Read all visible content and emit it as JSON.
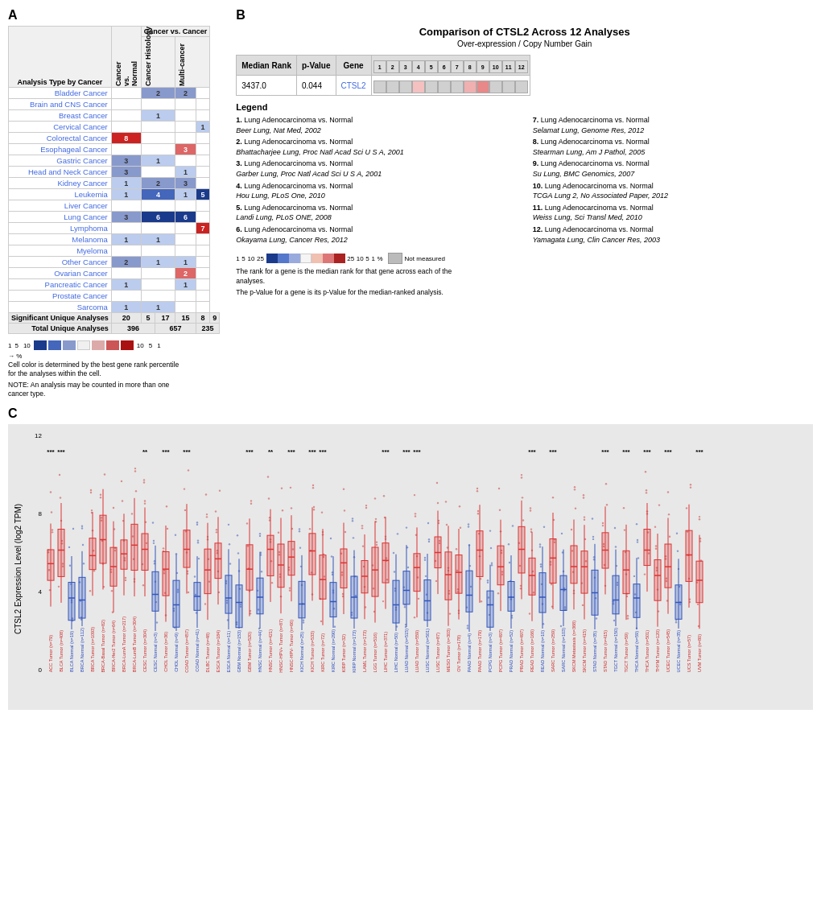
{
  "panels": {
    "a_label": "A",
    "b_label": "B",
    "c_label": "C"
  },
  "panel_a": {
    "title": "Analysis Type by Cancer",
    "headers": {
      "col1": "Cancer vs. Normal",
      "col2": "Cancer vs. Cancer",
      "sub1": "Cancer Histology",
      "sub2": "Multi-cancer"
    },
    "cancers": [
      {
        "name": "Bladder Cancer",
        "cn": "",
        "ch": "2",
        "mc": "2",
        "multi": ""
      },
      {
        "name": "Brain and CNS Cancer",
        "cn": "",
        "ch": "",
        "mc": "",
        "multi": ""
      },
      {
        "name": "Breast Cancer",
        "cn": "",
        "ch": "1",
        "mc": "",
        "multi": ""
      },
      {
        "name": "Cervical Cancer",
        "cn": "",
        "ch": "",
        "mc": "",
        "multi": "1"
      },
      {
        "name": "Colorectal Cancer",
        "cn": "8",
        "ch": "",
        "mc": "",
        "multi": ""
      },
      {
        "name": "Esophageal Cancer",
        "cn": "",
        "ch": "",
        "mc": "3",
        "multi": ""
      },
      {
        "name": "Gastric Cancer",
        "cn": "3",
        "ch": "1",
        "mc": "",
        "multi": ""
      },
      {
        "name": "Head and Neck Cancer",
        "cn": "3",
        "ch": "",
        "mc": "1",
        "multi": ""
      },
      {
        "name": "Kidney Cancer",
        "cn": "1",
        "ch": "2",
        "mc": "3",
        "multi": ""
      },
      {
        "name": "Leukemia",
        "cn": "1",
        "ch": "4",
        "mc": "1",
        "multi": "5"
      },
      {
        "name": "Liver Cancer",
        "cn": "",
        "ch": "",
        "mc": "",
        "multi": ""
      },
      {
        "name": "Lung Cancer",
        "cn": "3",
        "ch": "6",
        "mc": "6",
        "multi": ""
      },
      {
        "name": "Lymphoma",
        "cn": "",
        "ch": "",
        "mc": "",
        "multi": "7"
      },
      {
        "name": "Melanoma",
        "cn": "1",
        "ch": "1",
        "mc": "",
        "multi": ""
      },
      {
        "name": "Myeloma",
        "cn": "",
        "ch": "",
        "mc": "",
        "multi": ""
      },
      {
        "name": "Other Cancer",
        "cn": "2",
        "ch": "1",
        "mc": "1",
        "multi": ""
      },
      {
        "name": "Ovarian Cancer",
        "cn": "",
        "ch": "",
        "mc": "2",
        "multi": ""
      },
      {
        "name": "Pancreatic Cancer",
        "cn": "1",
        "ch": "",
        "mc": "1",
        "multi": ""
      },
      {
        "name": "Prostate Cancer",
        "cn": "",
        "ch": "",
        "mc": "",
        "multi": ""
      },
      {
        "name": "Sarcoma",
        "cn": "1",
        "ch": "1",
        "mc": "",
        "multi": ""
      }
    ],
    "summary": {
      "sig_label": "Significant Unique Analyses",
      "sig_values": [
        "20",
        "5",
        "17",
        "15",
        "8",
        "9"
      ],
      "total_label": "Total Unique Analyses",
      "total_values": [
        "396",
        "",
        "657",
        "",
        "235",
        ""
      ]
    },
    "legend": {
      "note1": "Cell color is determined by the best gene rank percentile for the analyses within the cell.",
      "note2": "NOTE: An analysis may be counted in more than one cancer type."
    }
  },
  "panel_b": {
    "title": "Comparison of CTSL2 Across 12 Analyses",
    "subtitle": "Over-expression / Copy Number Gain",
    "table": {
      "headers": [
        "Median Rank",
        "p-Value",
        "Gene"
      ],
      "row": [
        "3437.0",
        "0.044",
        "CTSL2"
      ]
    },
    "analysis_count": 12,
    "analysis_cells": [
      {
        "num": 1,
        "color": "#e8e8e8"
      },
      {
        "num": 2,
        "color": "#e8e8e8"
      },
      {
        "num": 3,
        "color": "#e8e8e8"
      },
      {
        "num": 4,
        "color": "#f5d5d5"
      },
      {
        "num": 5,
        "color": "#e8e8e8"
      },
      {
        "num": 6,
        "color": "#e8e8e8"
      },
      {
        "num": 7,
        "color": "#e8e8e8"
      },
      {
        "num": 8,
        "color": "#f5d5d5"
      },
      {
        "num": 9,
        "color": "#f0c0c0"
      },
      {
        "num": 10,
        "color": "#e8e8e8"
      },
      {
        "num": 11,
        "color": "#e8e8e8"
      },
      {
        "num": 12,
        "color": "#e8e8e8"
      }
    ],
    "legend_title": "Legend",
    "legend_items": [
      {
        "num": 1,
        "main": "Lung Adenocarcinoma vs. Normal",
        "sub": "Beer Lung, Nat Med, 2002"
      },
      {
        "num": 2,
        "main": "Lung Adenocarcinoma vs. Normal",
        "sub": "Bhattacharjee Lung, Proc Natl Acad Sci U S A, 2001"
      },
      {
        "num": 3,
        "main": "Lung Adenocarcinoma vs. Normal",
        "sub": "Garber Lung, Proc Natl Acad Sci U S A, 2001"
      },
      {
        "num": 4,
        "main": "Lung Adenocarcinoma vs. Normal",
        "sub": "Hou Lung, PLoS One, 2010"
      },
      {
        "num": 5,
        "main": "Lung Adenocarcinoma vs. Normal",
        "sub": "Landi Lung, PLoS ONE, 2008"
      },
      {
        "num": 6,
        "main": "Lung Adenocarcinoma vs. Normal",
        "sub": "Okayama Lung, Cancer Res, 2012"
      },
      {
        "num": 7,
        "main": "Lung Adenocarcinoma vs. Normal",
        "sub": "Selamat Lung, Genome Res, 2012"
      },
      {
        "num": 8,
        "main": "Lung Adenocarcinoma vs. Normal",
        "sub": "Stearman Lung, Am J Pathol, 2005"
      },
      {
        "num": 9,
        "main": "Lung Adenocarcinoma vs. Normal",
        "sub": "Su Lung, BMC Genomics, 2007"
      },
      {
        "num": 10,
        "main": "Lung Adenocarcinoma vs. Normal",
        "sub": "TCGA Lung 2, No Associated Paper, 2012"
      },
      {
        "num": 11,
        "main": "Lung Adenocarcinoma vs. Normal",
        "sub": "Weiss Lung, Sci Transl Med, 2010"
      },
      {
        "num": 12,
        "main": "Lung Adenocarcinoma vs. Normal",
        "sub": "Yamagata Lung, Clin Cancer Res, 2003"
      }
    ],
    "rank_note1": "The rank for a gene is the median rank for that gene across each of the analyses.",
    "rank_note2": "The p-Value for a gene is its p-Value for the median-ranked analysis.",
    "not_measured_label": "Not measured"
  },
  "panel_c": {
    "y_label": "CTSL2 Expression Level (log2 TPM)",
    "y_max": 12,
    "y_ticks": [
      0,
      4,
      8,
      12
    ],
    "groups": [
      {
        "label": "ACC Tumor (n=79)",
        "color": "red",
        "sig": "***"
      },
      {
        "label": "BLCA Tumor (n=408)",
        "color": "red",
        "sig": "***"
      },
      {
        "label": "BLCA Normal (n=19)",
        "color": "blue",
        "sig": null
      },
      {
        "label": "BRCA Normal (n=112)",
        "color": "blue",
        "sig": null
      },
      {
        "label": "BRCA Tumor (n=1093)",
        "color": "red",
        "sig": null
      },
      {
        "label": "BRCA-Basal Tumor (n=82)",
        "color": "red",
        "sig": null
      },
      {
        "label": "BRCA-Her2 Tumor (n=64)",
        "color": "red",
        "sig": null
      },
      {
        "label": "BRCA-LumA Tumor (n=217)",
        "color": "red",
        "sig": null
      },
      {
        "label": "BRCA-LumB Tumor (n=304)",
        "color": "red",
        "sig": null
      },
      {
        "label": "CESC Tumor (n=304)",
        "color": "red",
        "sig": "**"
      },
      {
        "label": "CESC Normal (n=3)",
        "color": "blue",
        "sig": null
      },
      {
        "label": "CHOL Tumor (n=36)",
        "color": "red",
        "sig": "***"
      },
      {
        "label": "CHOL Normal (n=9)",
        "color": "blue",
        "sig": null
      },
      {
        "label": "COAD Tumor (n=457)",
        "color": "red",
        "sig": "***"
      },
      {
        "label": "COAD Normal (n=41)",
        "color": "blue",
        "sig": null
      },
      {
        "label": "DLBC Tumor (n=48)",
        "color": "red",
        "sig": null
      },
      {
        "label": "ESCA Tumor (n=184)",
        "color": "red",
        "sig": null
      },
      {
        "label": "ESCA Normal (n=11)",
        "color": "blue",
        "sig": null
      },
      {
        "label": "GBM Normal (n=153)",
        "color": "blue",
        "sig": null
      },
      {
        "label": "GBM Tumor (n=520)",
        "color": "red",
        "sig": "***"
      },
      {
        "label": "HNSC Normal (n=44)",
        "color": "blue",
        "sig": null
      },
      {
        "label": "HNSC Tumor (n=421)",
        "color": "red",
        "sig": "**"
      },
      {
        "label": "HNSC-HPV+ Tumor (n=87)",
        "color": "red",
        "sig": null
      },
      {
        "label": "HNSC-HPV- Tumor (n=66)",
        "color": "red",
        "sig": "***"
      },
      {
        "label": "KICH Normal (n=25)",
        "color": "blue",
        "sig": null
      },
      {
        "label": "KICH Tumor (n=533)",
        "color": "red",
        "sig": "***"
      },
      {
        "label": "KIRC Tumor (n=72)",
        "color": "red",
        "sig": "***"
      },
      {
        "label": "KIRC Normal (n=290)",
        "color": "blue",
        "sig": null
      },
      {
        "label": "KIRP Tumor (n=32)",
        "color": "red",
        "sig": null
      },
      {
        "label": "KIRP Normal (n=173)",
        "color": "blue",
        "sig": null
      },
      {
        "label": "LAML Tumor (n=173)",
        "color": "red",
        "sig": null
      },
      {
        "label": "LGG Tumor (n=516)",
        "color": "red",
        "sig": null
      },
      {
        "label": "LIHC Tumor (n=371)",
        "color": "red",
        "sig": "***"
      },
      {
        "label": "LIHC Normal (n=50)",
        "color": "blue",
        "sig": null
      },
      {
        "label": "LUAD Normal (n=515)",
        "color": "blue",
        "sig": "***"
      },
      {
        "label": "LUAD Tumor (n=559)",
        "color": "red",
        "sig": "***"
      },
      {
        "label": "LUSC Normal (n=501)",
        "color": "blue",
        "sig": null
      },
      {
        "label": "LUSC Tumor (n=87)",
        "color": "red",
        "sig": null
      },
      {
        "label": "MESO Tumor (n=303)",
        "color": "red",
        "sig": null
      },
      {
        "label": "OV Tumor (n=178)",
        "color": "red",
        "sig": null
      },
      {
        "label": "PAAD Normal (n=4)",
        "color": "blue",
        "sig": null
      },
      {
        "label": "PAAD Tumor (n=179)",
        "color": "red",
        "sig": null
      },
      {
        "label": "PCPG Normal (n=3)",
        "color": "blue",
        "sig": null
      },
      {
        "label": "PCPG Tumor (n=497)",
        "color": "red",
        "sig": null
      },
      {
        "label": "PRAD Normal (n=52)",
        "color": "blue",
        "sig": null
      },
      {
        "label": "PRAD Tumor (n=497)",
        "color": "red",
        "sig": null
      },
      {
        "label": "READ Tumor (n=166)",
        "color": "red",
        "sig": "***"
      },
      {
        "label": "READ Normal (n=10)",
        "color": "blue",
        "sig": null
      },
      {
        "label": "SARC Tumor (n=259)",
        "color": "red",
        "sig": "***"
      },
      {
        "label": "SARC Normal (n=103)",
        "color": "blue",
        "sig": null
      },
      {
        "label": "SKCM Metastasis (n=368)",
        "color": "red",
        "sig": null
      },
      {
        "label": "SKCM Tumor (n=415)",
        "color": "red",
        "sig": null
      },
      {
        "label": "STAD Normal (n=35)",
        "color": "blue",
        "sig": null
      },
      {
        "label": "STAD Tumor (n=415)",
        "color": "red",
        "sig": "***"
      },
      {
        "label": "TGCT Normal (n=150)",
        "color": "blue",
        "sig": null
      },
      {
        "label": "TGCT Tumor (n=59)",
        "color": "red",
        "sig": "***"
      },
      {
        "label": "THCA Normal (n=59)",
        "color": "blue",
        "sig": null
      },
      {
        "label": "THCA Tumor (n=501)",
        "color": "red",
        "sig": "***"
      },
      {
        "label": "THYM Tumor (n=120)",
        "color": "red",
        "sig": null
      },
      {
        "label": "UCEC Tumor (n=545)",
        "color": "red",
        "sig": "***"
      },
      {
        "label": "UCEC Normal (n=35)",
        "color": "blue",
        "sig": null
      },
      {
        "label": "UCS Tumor (n=57)",
        "color": "red",
        "sig": null
      },
      {
        "label": "UVM Tumor (n=80)",
        "color": "red",
        "sig": "***"
      }
    ]
  }
}
